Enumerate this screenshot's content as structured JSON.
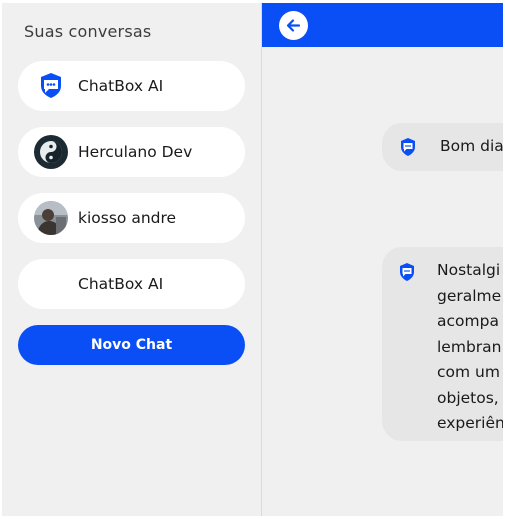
{
  "sidebar": {
    "title": "Suas conversas",
    "items": [
      {
        "label": "ChatBox AI",
        "avatar": "chatbot-icon"
      },
      {
        "label": "Herculano Dev",
        "avatar": "yin-yang-avatar"
      },
      {
        "label": "kiosso andre",
        "avatar": "user-photo-avatar"
      },
      {
        "label": "ChatBox AI",
        "avatar": "none"
      }
    ],
    "new_chat_label": "Novo Chat"
  },
  "header": {
    "back_icon": "arrow-left-icon"
  },
  "messages": [
    {
      "sender": "bot",
      "text": "Bom dia"
    },
    {
      "sender": "bot",
      "lines": [
        "Nostalgi",
        "geralme",
        "acompa",
        "lembran",
        "com um",
        "objetos,",
        "experiên"
      ]
    }
  ],
  "colors": {
    "accent": "#0a4ff5",
    "sidebar_bg": "#f0f0f0",
    "bubble_bg": "#e6e6e6",
    "item_bg": "#ffffff"
  }
}
